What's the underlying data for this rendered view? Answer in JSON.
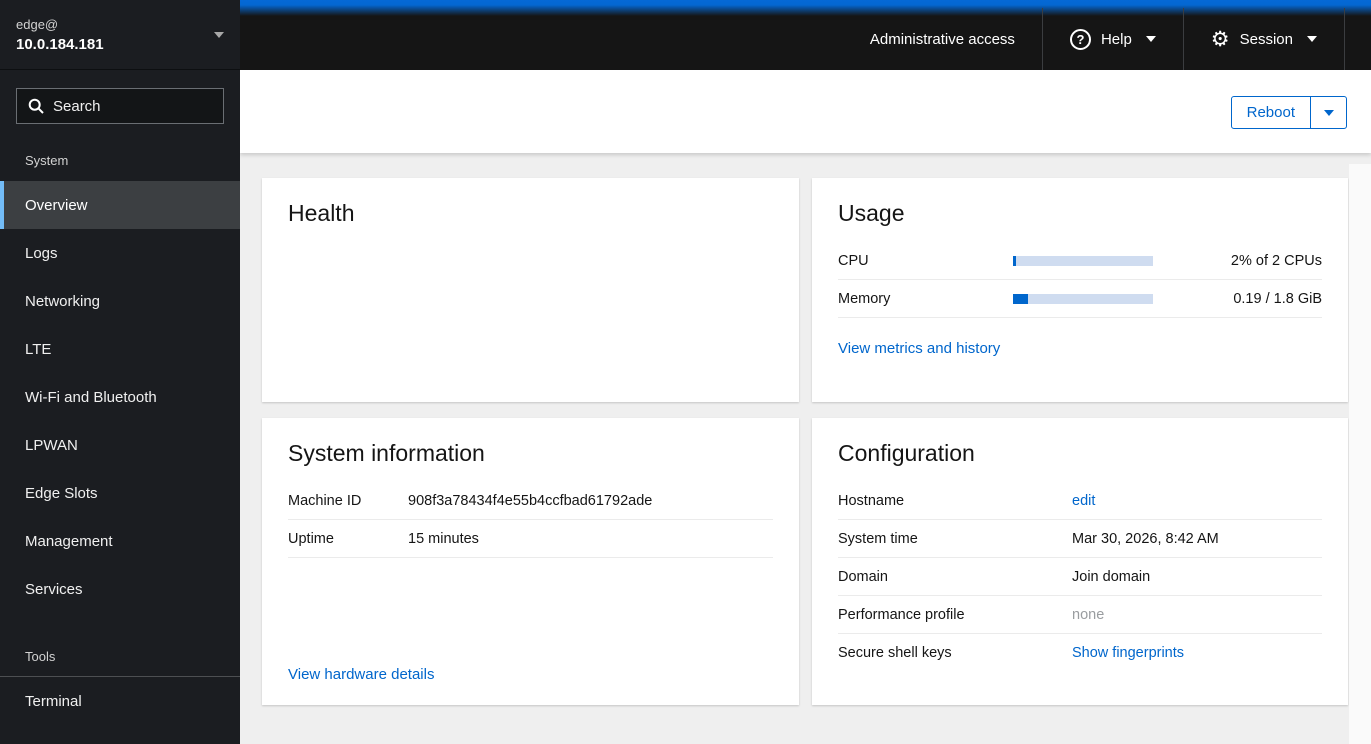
{
  "sidebar": {
    "user": "edge@",
    "host": "10.0.184.181",
    "search_placeholder": "Search",
    "sections": [
      {
        "label": "System",
        "items": [
          {
            "label": "Overview",
            "active": true
          },
          {
            "label": "Logs"
          },
          {
            "label": "Networking"
          },
          {
            "label": "LTE"
          },
          {
            "label": "Wi-Fi and Bluetooth"
          },
          {
            "label": "LPWAN"
          },
          {
            "label": "Edge Slots"
          },
          {
            "label": "Management"
          },
          {
            "label": "Services"
          }
        ]
      },
      {
        "label": "Tools",
        "items": [
          {
            "label": "Terminal"
          }
        ]
      }
    ]
  },
  "masthead": {
    "admin_access_label": "Administrative access",
    "help_label": "Help",
    "session_label": "Session"
  },
  "toolbar": {
    "reboot_label": "Reboot"
  },
  "cards": {
    "health": {
      "title": "Health"
    },
    "usage": {
      "title": "Usage",
      "rows": [
        {
          "label": "CPU",
          "value": "2% of 2 CPUs",
          "percent": 2
        },
        {
          "label": "Memory",
          "value": "0.19 / 1.8 GiB",
          "percent": 10.6
        }
      ],
      "link_label": "View metrics and history"
    },
    "system_information": {
      "title": "System information",
      "rows": [
        {
          "label": "Machine ID",
          "value": "908f3a78434f4e55b4ccfbad61792ade"
        },
        {
          "label": "Uptime",
          "value": "15 minutes"
        }
      ],
      "link_label": "View hardware details"
    },
    "configuration": {
      "title": "Configuration",
      "rows": [
        {
          "label": "Hostname",
          "value": "edit"
        },
        {
          "label": "System time",
          "value": "Mar 30, 2026, 8:42 AM"
        },
        {
          "label": "Domain",
          "value": "Join domain"
        },
        {
          "label": "Performance profile",
          "value": "none"
        },
        {
          "label": "Secure shell keys",
          "value": "Show fingerprints"
        }
      ]
    }
  },
  "colors": {
    "accent_blue": "#0066cc",
    "masthead_bg": "#151515",
    "sidebar_bg": "#1b1d21",
    "selected_item_bg": "#3c3f42",
    "selected_item_border": "#73bcf7",
    "progress_track": "#cfdcf0",
    "progress_fill": "#0066cc",
    "muted_text": "#9a9da0",
    "content_bg": "#efefef"
  },
  "icons": {
    "search": "magnifier-icon",
    "help": "question-circle-icon",
    "session": "gear-icon",
    "dropdown": "caret-down-icon"
  }
}
